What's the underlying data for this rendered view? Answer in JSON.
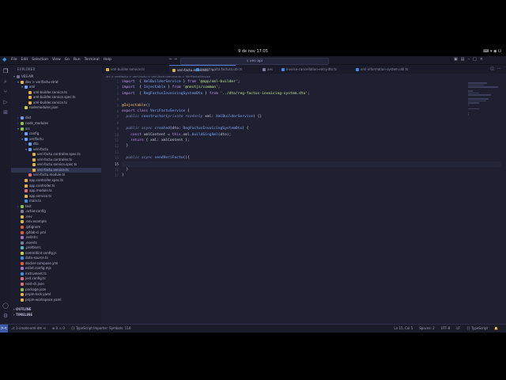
{
  "system": {
    "clock": "9 de nov  17:05",
    "tray": "⌨ ▾ ◉ ⏻"
  },
  "window": {
    "menu": [
      "File",
      "Edit",
      "Selection",
      "View",
      "Go",
      "Run",
      "Terminal",
      "Help"
    ],
    "search_text": "ves-api"
  },
  "sidebar": {
    "title": "EXPLORER",
    "tree": [
      {
        "label": "VES-API",
        "depth": 0,
        "chev": "▾",
        "icon": "#6b7090",
        "name": "root-folder"
      },
      {
        "label": "dev > verifactu-strat",
        "depth": 1,
        "chev": "▾",
        "icon": "#e6b450",
        "name": "folder-dev"
      },
      {
        "label": "xml",
        "depth": 2,
        "chev": "▾",
        "icon": "#6c9ef8",
        "name": "folder-xml"
      },
      {
        "label": "xml-builder.service.ts",
        "depth": 3,
        "chev": "",
        "icon": "#e0b040",
        "name": "file-xml-builder-service"
      },
      {
        "label": "xml-builder.service.spec.ts",
        "depth": 3,
        "chev": "",
        "icon": "#e0b040",
        "name": "file-xml-builder-spec"
      },
      {
        "label": "xml-builder.service.ts",
        "depth": 3,
        "chev": "",
        "icon": "#e0b040",
        "name": "file-xml-builder-service-2"
      },
      {
        "label": "nodemodules.json",
        "depth": 2,
        "chev": "",
        "icon": "#cbcb41",
        "name": "file-nodemodules"
      },
      {
        "label": "",
        "depth": 0,
        "chev": "",
        "icon": "",
        "name": "spacer"
      },
      {
        "label": "dist",
        "depth": 1,
        "chev": "›",
        "icon": "#6c9ef8",
        "name": "folder-dist"
      },
      {
        "label": "node_modules",
        "depth": 1,
        "chev": "›",
        "icon": "#8bc34a",
        "name": "folder-node-modules"
      },
      {
        "label": "src",
        "depth": 1,
        "chev": "▾",
        "icon": "#8bc34a",
        "name": "folder-src"
      },
      {
        "label": "config",
        "depth": 2,
        "chev": "›",
        "icon": "#6c9ef8",
        "name": "folder-config"
      },
      {
        "label": "verifactu",
        "depth": 2,
        "chev": "▾",
        "icon": "#6c9ef8",
        "name": "folder-verifactu"
      },
      {
        "label": "dto",
        "depth": 3,
        "chev": "›",
        "icon": "#6c9ef8",
        "name": "folder-dto"
      },
      {
        "label": "veri-factu",
        "depth": 3,
        "chev": "▾",
        "icon": "#6c9ef8",
        "name": "folder-veri-factu"
      },
      {
        "label": "veri-factu.controller.spec.ts",
        "depth": 4,
        "chev": "",
        "icon": "#e0b040",
        "name": "file-vf-controller-spec"
      },
      {
        "label": "veri-factu.controller.ts",
        "depth": 4,
        "chev": "",
        "icon": "#e0b040",
        "name": "file-vf-controller"
      },
      {
        "label": "veri-factu.service.spec.ts",
        "depth": 4,
        "chev": "",
        "icon": "#e0b040",
        "name": "file-vf-service-spec"
      },
      {
        "label": "veri-factu.service.ts",
        "depth": 4,
        "chev": "",
        "icon": "#e0b040",
        "name": "file-vf-service",
        "selected": true
      },
      {
        "label": "veri-factu.module.ts",
        "depth": 3,
        "chev": "",
        "icon": "#e06c75",
        "name": "file-vf-module"
      },
      {
        "label": "app.controller.spec.ts",
        "depth": 2,
        "chev": "",
        "icon": "#e0b040",
        "name": "file-app-controller-spec"
      },
      {
        "label": "app.controller.ts",
        "depth": 2,
        "chev": "",
        "icon": "#e0b040",
        "name": "file-app-controller"
      },
      {
        "label": "app.module.ts",
        "depth": 2,
        "chev": "",
        "icon": "#e06c75",
        "name": "file-app-module"
      },
      {
        "label": "app.service.ts",
        "depth": 2,
        "chev": "",
        "icon": "#e0b040",
        "name": "file-app-service"
      },
      {
        "label": "main.ts",
        "depth": 2,
        "chev": "",
        "icon": "#3d8fe0",
        "name": "file-main"
      },
      {
        "label": "test",
        "depth": 1,
        "chev": "›",
        "icon": "#8bc34a",
        "name": "folder-test"
      },
      {
        "label": ".actionconfig",
        "depth": 1,
        "chev": "",
        "icon": "#7a7f9a",
        "name": "file-actionconfig"
      },
      {
        "label": ".env",
        "depth": 1,
        "chev": "",
        "icon": "#d6b84e",
        "name": "file-env"
      },
      {
        "label": ".env.example",
        "depth": 1,
        "chev": "",
        "icon": "#d6b84e",
        "name": "file-env-example"
      },
      {
        "label": ".gitignore",
        "depth": 1,
        "chev": "",
        "icon": "#e45a3b",
        "name": "file-gitignore"
      },
      {
        "label": ".gitlab-ci.yml",
        "depth": 1,
        "chev": "",
        "icon": "#e45a3b",
        "name": "file-gitlab-ci"
      },
      {
        "label": ".eslintrc",
        "depth": 1,
        "chev": "",
        "icon": "#a074c4",
        "name": "file-eslintrc"
      },
      {
        "label": ".events",
        "depth": 1,
        "chev": "",
        "icon": "#7a7f9a",
        "name": "file-events"
      },
      {
        "label": ".prettierrc",
        "depth": 1,
        "chev": "",
        "icon": "#56b6c2",
        "name": "file-prettierrc"
      },
      {
        "label": "commitlint.config.js",
        "depth": 1,
        "chev": "",
        "icon": "#cbcb41",
        "name": "file-commitlint"
      },
      {
        "label": "data-source.ts",
        "depth": 1,
        "chev": "",
        "icon": "#3d8fe0",
        "name": "file-data-source"
      },
      {
        "label": "docker-compose.yml",
        "depth": 1,
        "chev": "",
        "icon": "#e45a3b",
        "name": "file-docker-compose"
      },
      {
        "label": "eslint.config.mjs",
        "depth": 1,
        "chev": "",
        "icon": "#a074c4",
        "name": "file-eslint-config"
      },
      {
        "label": "instrument.ts",
        "depth": 1,
        "chev": "",
        "icon": "#3d8fe0",
        "name": "file-instrument"
      },
      {
        "label": "jest.config.ts",
        "depth": 1,
        "chev": "",
        "icon": "#e06c75",
        "name": "file-jest-config"
      },
      {
        "label": "nest-cli.json",
        "depth": 1,
        "chev": "",
        "icon": "#e06c75",
        "name": "file-nest-cli"
      },
      {
        "label": "package.json",
        "depth": 1,
        "chev": "",
        "icon": "#8bc34a",
        "name": "file-package-json"
      },
      {
        "label": "pnpm-lock.yaml",
        "depth": 1,
        "chev": "",
        "icon": "#e0b040",
        "name": "file-pnpm-lock"
      },
      {
        "label": "pnpm-workspace.yaml",
        "depth": 1,
        "chev": "",
        "icon": "#e0b040",
        "name": "file-pnpm-workspace"
      }
    ],
    "sections": [
      "OUTLINE",
      "TIMELINE"
    ]
  },
  "editor": {
    "tabs": [
      {
        "label": "xml-builder.service.ts",
        "icon": "#e0b040",
        "active": false
      },
      {
        "label": "veri-factu.service.ts",
        "icon": "#e0b040",
        "active": true
      },
      {
        "label": "registro-alta.factura.util.ts",
        "icon": "#3d8fe0",
        "active": false
      },
      {
        "label": "aes",
        "icon": "#7a7f9a",
        "active": false
      },
      {
        "label": "invoice-cancellation-entry.dto.ts",
        "icon": "#3d8fe0",
        "active": false
      },
      {
        "label": "xml-information-system.util.ts",
        "icon": "#3d8fe0",
        "active": false
      }
    ],
    "breadcrumbs": "src > verifactu > veri-factu > veri-factu.service.ts > VeriFactuService",
    "current_line": 15,
    "lines": [
      [
        [
          "kw",
          "import"
        ],
        [
          "",
          "  { "
        ],
        [
          "ty",
          "XmlBuilderService"
        ],
        [
          "",
          " } "
        ],
        [
          "kw",
          "from"
        ],
        [
          "",
          " "
        ],
        [
          "str",
          "'@app/xml-builder'"
        ],
        [
          "",
          ";"
        ]
      ],
      [
        [
          "kw",
          "import"
        ],
        [
          "",
          "  { "
        ],
        [
          "ty",
          "Injectable"
        ],
        [
          "",
          " } "
        ],
        [
          "kw",
          "from"
        ],
        [
          "",
          " "
        ],
        [
          "str",
          "'@nestjs/common'"
        ],
        [
          "",
          ";"
        ]
      ],
      [
        [
          "kw",
          "import"
        ],
        [
          "",
          "  { "
        ],
        [
          "ty",
          "RegFactusInvoicingSystemDto"
        ],
        [
          "",
          " } "
        ],
        [
          "kw",
          "from"
        ],
        [
          "",
          " "
        ],
        [
          "str",
          "'../dto/reg-factus-invoicing-system.dto'"
        ],
        [
          "",
          ";"
        ]
      ],
      [],
      [
        [
          "dec",
          "@Injectable"
        ],
        [
          "",
          "()"
        ]
      ],
      [
        [
          "kw",
          "export class"
        ],
        [
          "",
          " "
        ],
        [
          "ty",
          "VeriFactuService"
        ],
        [
          "",
          " {"
        ]
      ],
      [
        [
          "",
          "  "
        ],
        [
          "it",
          "public"
        ],
        [
          "",
          " "
        ],
        [
          "fn",
          "constructor"
        ],
        [
          "",
          "("
        ],
        [
          "it",
          "private readonly"
        ],
        [
          "",
          " xml: "
        ],
        [
          "ty",
          "XmlBuilderService"
        ],
        [
          "",
          ") {}"
        ]
      ],
      [],
      [
        [
          "",
          "  "
        ],
        [
          "it",
          "public async"
        ],
        [
          "",
          " "
        ],
        [
          "fn",
          "created"
        ],
        [
          "",
          "(dto: "
        ],
        [
          "ty",
          "RegFactusInvoicingSystemDto"
        ],
        [
          "",
          ") {"
        ]
      ],
      [
        [
          "",
          "    "
        ],
        [
          "kw",
          "const"
        ],
        [
          "",
          " xmlContent = "
        ],
        [
          "kw",
          "this"
        ],
        [
          "",
          ".xml."
        ],
        [
          "fn",
          "buildSingXml"
        ],
        [
          "",
          "(dto);"
        ]
      ],
      [
        [
          "",
          "    "
        ],
        [
          "kw",
          "return"
        ],
        [
          "",
          " { xml: xmlContent };"
        ]
      ],
      [
        [
          "",
          "  }"
        ]
      ],
      [],
      [
        [
          "",
          "  "
        ],
        [
          "it",
          "public async"
        ],
        [
          "",
          " "
        ],
        [
          "fn",
          "sendVeriFactu"
        ],
        [
          "",
          "(){"
        ]
      ],
      [],
      [
        [
          "",
          "  }"
        ]
      ],
      [
        [
          "",
          "}"
        ]
      ]
    ]
  },
  "statusbar": {
    "remote": "><",
    "left": [
      "⎇ 1-create-xml-dm ⟲",
      "⊗ 0 ⚠ 0",
      "{} TypeScript Importer: Symbols: 114"
    ],
    "right": [
      "Ln 15, Col 5",
      "Spaces: 2",
      "UTF-8",
      "LF",
      "{} TypeScript",
      "🔔"
    ]
  },
  "colors": {
    "accent": "#3d5aa8",
    "editor_bg": "#1e2031",
    "sidebar_bg": "#1b1d2c"
  }
}
